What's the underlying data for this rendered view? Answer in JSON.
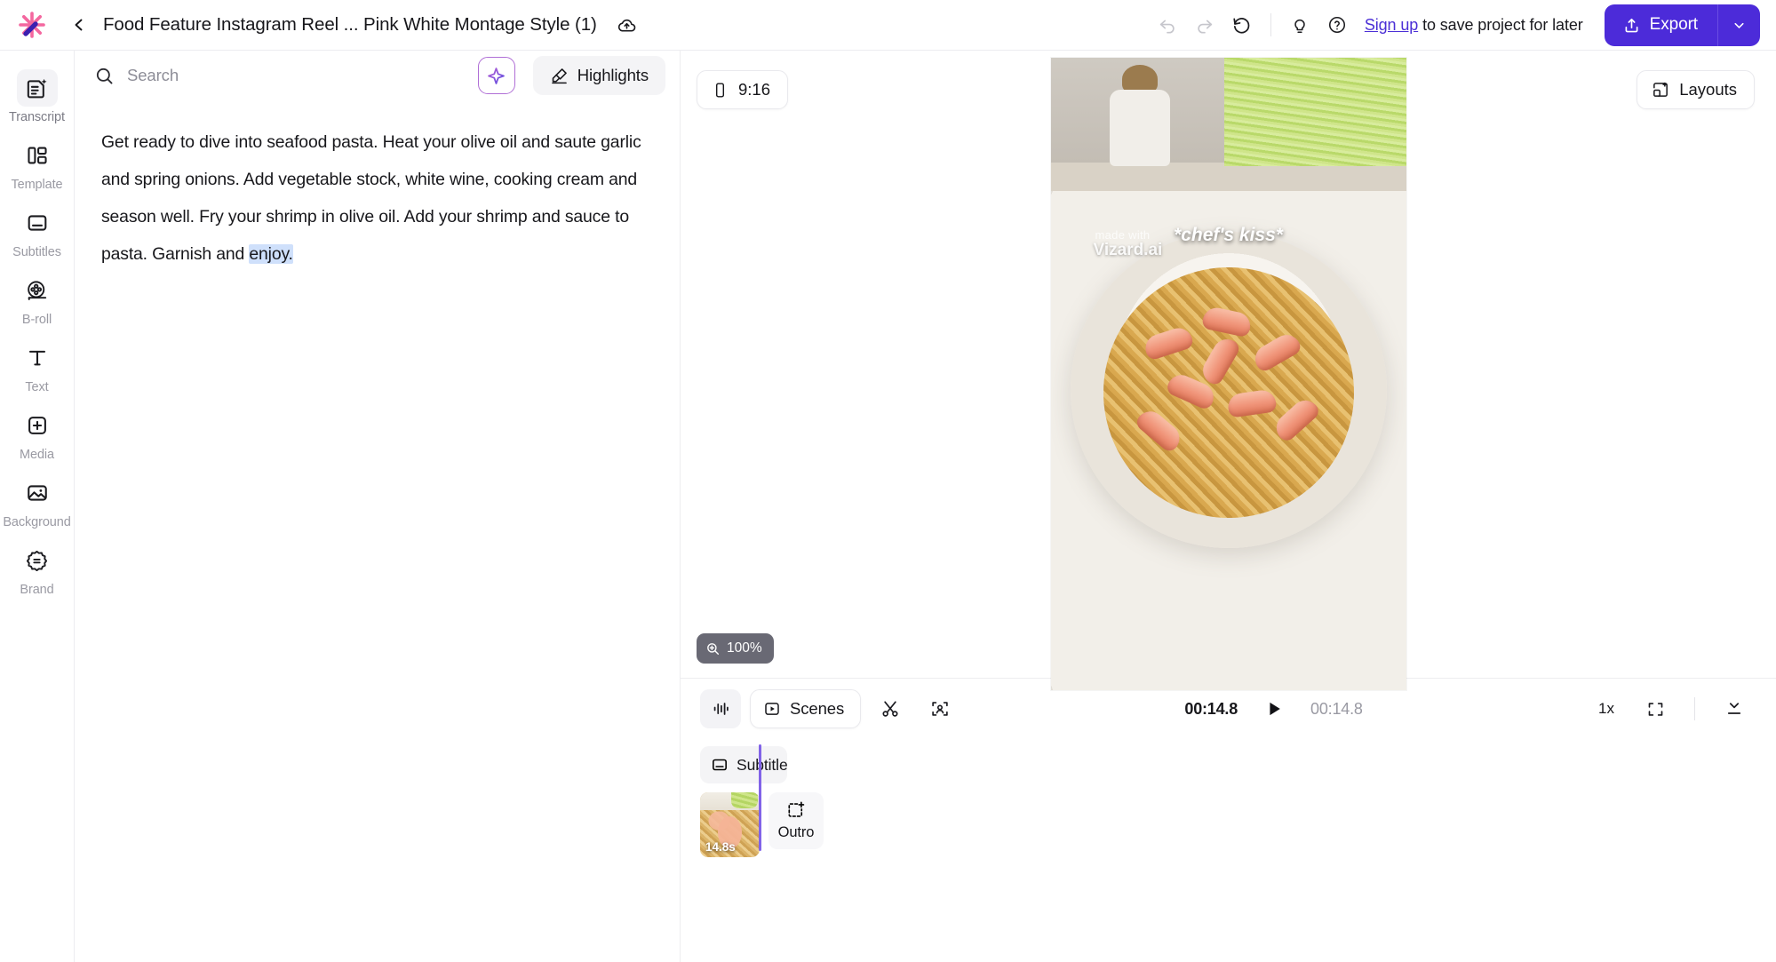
{
  "app": {
    "logo_icon": "vizard-sparkle-logo"
  },
  "header": {
    "back_icon": "chevron-left-icon",
    "project_title": "Food Feature Instagram Reel ... Pink White Montage Style (1)",
    "cloud_icon": "cloud-upload-icon",
    "undo_icon": "undo-icon",
    "redo_icon": "redo-icon",
    "revert_icon": "history-revert-icon",
    "idea_icon": "lightbulb-icon",
    "help_icon": "help-circle-icon",
    "signup_link": "Sign up",
    "signup_suffix": " to save project for later",
    "export_label": "Export",
    "export_icon": "export-share-icon",
    "export_caret_icon": "chevron-down-icon",
    "accent_color": "#4c2bd9"
  },
  "sidebar": {
    "items": [
      {
        "label": "Transcript",
        "icon": "transcript-icon",
        "active": true
      },
      {
        "label": "Template",
        "icon": "template-icon",
        "active": false
      },
      {
        "label": "Subtitles",
        "icon": "subtitles-icon",
        "active": false
      },
      {
        "label": "B-roll",
        "icon": "film-reel-icon",
        "active": false
      },
      {
        "label": "Text",
        "icon": "text-t-icon",
        "active": false
      },
      {
        "label": "Media",
        "icon": "media-plus-icon",
        "active": false
      },
      {
        "label": "Background",
        "icon": "image-icon",
        "active": false
      },
      {
        "label": "Brand",
        "icon": "brand-badge-icon",
        "active": false
      }
    ]
  },
  "transcript": {
    "search_placeholder": "Search",
    "search_value": "",
    "search_icon": "search-icon",
    "ai_icon": "ai-sparkle-icon",
    "highlights_label": "Highlights",
    "highlights_icon": "highlighter-pen-icon",
    "text_before": "Get ready to dive into seafood pasta. Heat your olive oil and saute garlic and spring onions. Add vegetable stock, white wine, cooking cream and season well. Fry your shrimp in olive oil. Add your shrimp and sauce to pasta. Garnish and ",
    "text_selected": "enjoy.",
    "selection_color": "#cfe0fb"
  },
  "preview": {
    "ratio_label": "9:16",
    "ratio_icon": "phone-portrait-icon",
    "layouts_label": "Layouts",
    "layouts_icon": "layouts-icon",
    "zoom_label": "100%",
    "zoom_icon": "zoom-in-icon",
    "caption_text": "*chef's kiss*",
    "watermark_small": "made with",
    "watermark_brand": "Vizard.ai"
  },
  "timeline": {
    "waveform_icon": "audio-waveform-icon",
    "scenes_label": "Scenes",
    "scenes_icon": "play-square-icon",
    "cut_icon": "scissors-icon",
    "face_icon": "face-track-icon",
    "current_time": "00:14.8",
    "total_time": "00:14.8",
    "play_icon": "play-icon",
    "speed_label": "1x",
    "fullscreen_icon": "fullscreen-icon",
    "collapse_icon": "collapse-panel-icon",
    "playhead_color": "#8163e8",
    "subtitle_track": {
      "label": "Subtitles",
      "icon": "subtitle-box-icon"
    },
    "clips": [
      {
        "duration_label": "14.8s",
        "name": "pasta-clip-thumbnail"
      }
    ],
    "outro": {
      "label": "Outro",
      "icon": "add-outro-icon"
    }
  }
}
